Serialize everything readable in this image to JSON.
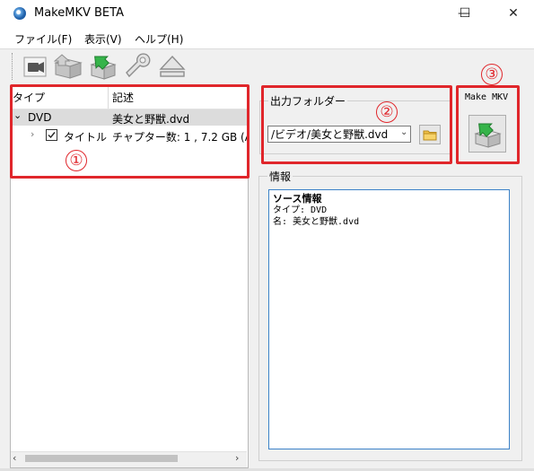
{
  "window": {
    "title": "MakeMKV BETA",
    "minimize": "—",
    "maximize": "☐",
    "close": "✕"
  },
  "menu": [
    {
      "label": "ファイル(F)"
    },
    {
      "label": "表示(V)"
    },
    {
      "label": "ヘルプ(H)"
    }
  ],
  "toolbar": {
    "buttons": [
      "open-files-icon",
      "open-disc-icon",
      "backup-icon",
      "settings-wrench-icon",
      "eject-icon"
    ]
  },
  "tree": {
    "columns": [
      "タイプ",
      "記述"
    ],
    "rows": [
      {
        "type": "DVD",
        "desc": "美女と野獣.dvd",
        "expanded": true,
        "selected": true
      },
      {
        "type": "タイトル",
        "desc": "チャプター数: 1 , 7.2 GB (A",
        "checked": true
      }
    ]
  },
  "output": {
    "label": "出力フォルダー",
    "folder": "/ビデオ/美女と野獣.dvd"
  },
  "makemkv": {
    "label": "Make MKV"
  },
  "info": {
    "label": "情報",
    "heading": "ソース情報",
    "type_line": "タイプ: DVD",
    "name_line": "名: 美女と野獣.dvd"
  },
  "callouts": [
    "①",
    "②",
    "③"
  ],
  "colors": {
    "highlight_red": "#e0262b",
    "info_border": "#3c82c8",
    "selection_gray": "#dcdcdc"
  }
}
